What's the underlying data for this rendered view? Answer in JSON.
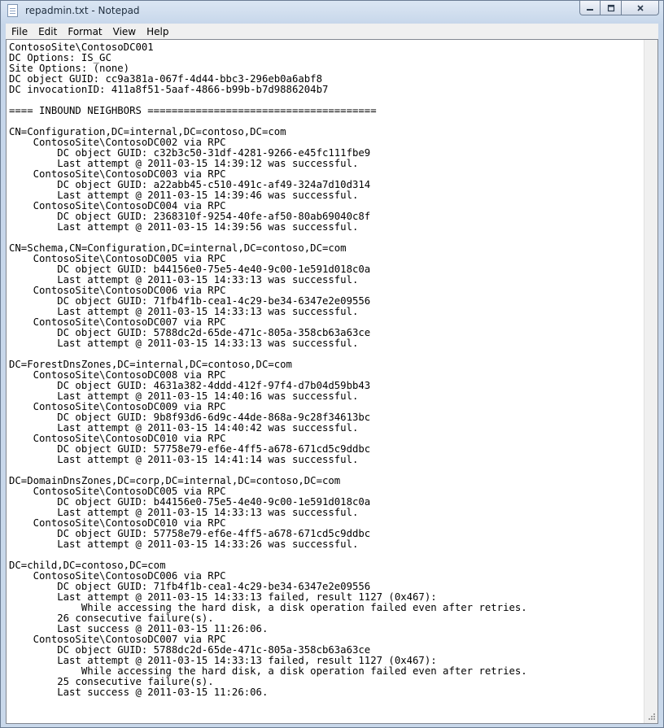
{
  "window": {
    "title": "repadmin.txt - Notepad",
    "icon": "notepad-icon"
  },
  "menu": [
    "File",
    "Edit",
    "Format",
    "View",
    "Help"
  ],
  "document": {
    "lines": [
      "ContosoSite\\ContosoDC001",
      "DC Options: IS_GC",
      "Site Options: (none)",
      "DC object GUID: cc9a381a-067f-4d44-bbc3-296eb0a6abf8",
      "DC invocationID: 411a8f51-5aaf-4866-b99b-b7d9886204b7",
      "",
      "==== INBOUND NEIGHBORS ======================================",
      "",
      "CN=Configuration,DC=internal,DC=contoso,DC=com",
      "    ContosoSite\\ContosoDC002 via RPC",
      "        DC object GUID: c32b3c50-31df-4281-9266-e45fc111fbe9",
      "        Last attempt @ 2011-03-15 14:39:12 was successful.",
      "    ContosoSite\\ContosoDC003 via RPC",
      "        DC object GUID: a22abb45-c510-491c-af49-324a7d10d314",
      "        Last attempt @ 2011-03-15 14:39:46 was successful.",
      "    ContosoSite\\ContosoDC004 via RPC",
      "        DC object GUID: 2368310f-9254-40fe-af50-80ab69040c8f",
      "        Last attempt @ 2011-03-15 14:39:56 was successful.",
      "",
      "CN=Schema,CN=Configuration,DC=internal,DC=contoso,DC=com",
      "    ContosoSite\\ContosoDC005 via RPC",
      "        DC object GUID: b44156e0-75e5-4e40-9c00-1e591d018c0a",
      "        Last attempt @ 2011-03-15 14:33:13 was successful.",
      "    ContosoSite\\ContosoDC006 via RPC",
      "        DC object GUID: 71fb4f1b-cea1-4c29-be34-6347e2e09556",
      "        Last attempt @ 2011-03-15 14:33:13 was successful.",
      "    ContosoSite\\ContosoDC007 via RPC",
      "        DC object GUID: 5788dc2d-65de-471c-805a-358cb63a63ce",
      "        Last attempt @ 2011-03-15 14:33:13 was successful.",
      "",
      "DC=ForestDnsZones,DC=internal,DC=contoso,DC=com",
      "    ContosoSite\\ContosoDC008 via RPC",
      "        DC object GUID: 4631a382-4ddd-412f-97f4-d7b04d59bb43",
      "        Last attempt @ 2011-03-15 14:40:16 was successful.",
      "    ContosoSite\\ContosoDC009 via RPC",
      "        DC object GUID: 9b8f93d6-6d9c-44de-868a-9c28f34613bc",
      "        Last attempt @ 2011-03-15 14:40:42 was successful.",
      "    ContosoSite\\ContosoDC010 via RPC",
      "        DC object GUID: 57758e79-ef6e-4ff5-a678-671cd5c9ddbc",
      "        Last attempt @ 2011-03-15 14:41:14 was successful.",
      "",
      "DC=DomainDnsZones,DC=corp,DC=internal,DC=contoso,DC=com",
      "    ContosoSite\\ContosoDC005 via RPC",
      "        DC object GUID: b44156e0-75e5-4e40-9c00-1e591d018c0a",
      "        Last attempt @ 2011-03-15 14:33:13 was successful.",
      "    ContosoSite\\ContosoDC010 via RPC",
      "        DC object GUID: 57758e79-ef6e-4ff5-a678-671cd5c9ddbc",
      "        Last attempt @ 2011-03-15 14:33:26 was successful.",
      "",
      "DC=child,DC=contoso,DC=com",
      "    ContosoSite\\ContosoDC006 via RPC",
      "        DC object GUID: 71fb4f1b-cea1-4c29-be34-6347e2e09556",
      "        Last attempt @ 2011-03-15 14:33:13 failed, result 1127 (0x467):",
      "            While accessing the hard disk, a disk operation failed even after retries.",
      "        26 consecutive failure(s).",
      "        Last success @ 2011-03-15 11:26:06.",
      "    ContosoSite\\ContosoDC007 via RPC",
      "        DC object GUID: 5788dc2d-65de-471c-805a-358cb63a63ce",
      "        Last attempt @ 2011-03-15 14:33:13 failed, result 1127 (0x467):",
      "            While accessing the hard disk, a disk operation failed even after retries.",
      "        25 consecutive failure(s).",
      "        Last success @ 2011-03-15 11:26:06."
    ]
  }
}
